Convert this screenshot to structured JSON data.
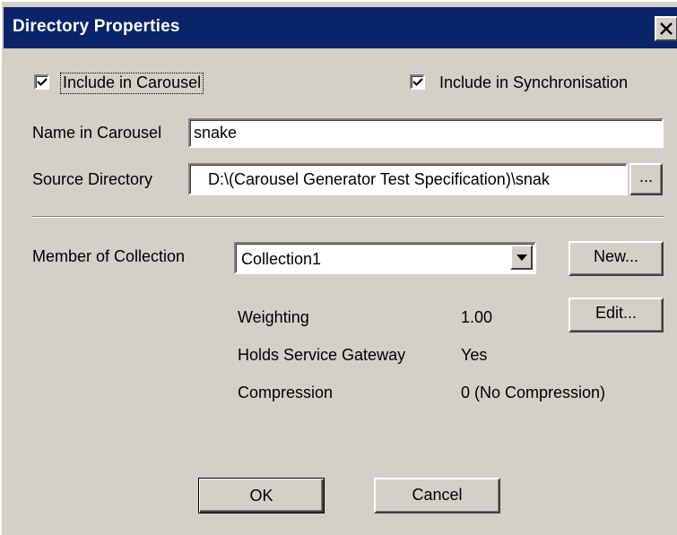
{
  "window": {
    "title": "Directory Properties",
    "close_icon": "close-icon"
  },
  "options": {
    "include_in_carousel": {
      "label": "Include in Carousel",
      "checked": true
    },
    "include_in_synchronisation": {
      "label": "Include in Synchronisation",
      "checked": true
    }
  },
  "name": {
    "label": "Name in Carousel",
    "value": "snake"
  },
  "source": {
    "label": "Source Directory",
    "value": "D:\\(Carousel Generator Test Specification)\\snak",
    "browse_label": "..."
  },
  "collection": {
    "label": "Member of Collection",
    "selected": "Collection1",
    "new_label": "New...",
    "edit_label": "Edit..."
  },
  "properties": [
    {
      "name": "Weighting",
      "value": "1.00"
    },
    {
      "name": "Holds Service Gateway",
      "value": "Yes"
    },
    {
      "name": "Compression",
      "value": "0 (No Compression)"
    }
  ],
  "actions": {
    "ok_label": "OK",
    "cancel_label": "Cancel"
  },
  "colors": {
    "titlebar": "#0a246a",
    "face": "#d4d0c8"
  }
}
